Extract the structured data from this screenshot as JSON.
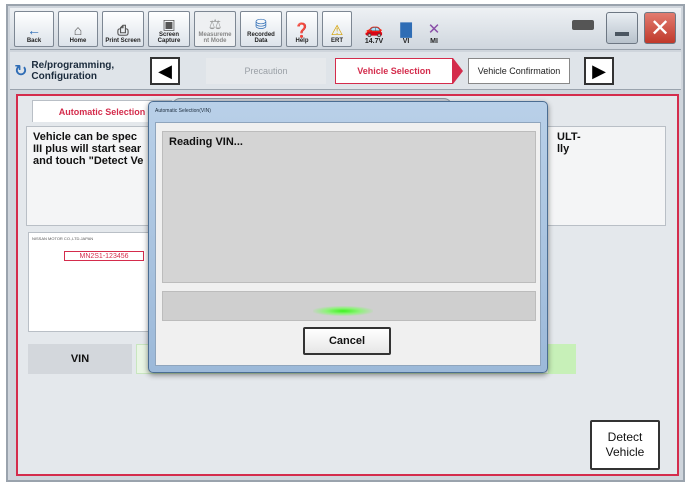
{
  "toolbar": {
    "back": "Back",
    "home": "Home",
    "print_screen": "Print Screen",
    "screen_capture": "Screen Capture",
    "measurement_mode": "Measureme nt Mode",
    "recorded_data": "Recorded Data",
    "help": "Help",
    "ert": "ERT",
    "voltage": "14.7V",
    "vi": "VI",
    "mi": "MI"
  },
  "nav": {
    "title": "Re/programming, Configuration",
    "step_precaution": "Precaution",
    "step_vehicle_selection": "Vehicle Selection",
    "step_vehicle_confirmation": "Vehicle Confirmation"
  },
  "main": {
    "tab_auto": "Automatic Selection",
    "description_left": "Vehicle can be spec\nIII plus will start sear\nand touch \"Detect Ve",
    "description_right": "ULT-\nlly",
    "sample_vin": "MN2S1-123456",
    "sample_maker": "NISSAN MOTOR CO.,LTD.JAPAN",
    "vin_label": "VIN",
    "detect_button": "Detect Vehicle"
  },
  "dialog": {
    "title": "Automatic Selection(VIN)",
    "status": "Reading VIN...",
    "cancel": "Cancel"
  },
  "colors": {
    "accent_red": "#d42c4c",
    "progress_green": "#3df21f",
    "close_red": "#c0392b"
  }
}
